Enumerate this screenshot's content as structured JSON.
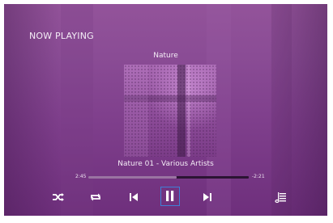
{
  "header": {
    "title": "NOW PLAYING"
  },
  "album": {
    "name": "Nature"
  },
  "track": {
    "info": "Nature 01 - Various Artists"
  },
  "progress": {
    "elapsed": "2:45",
    "remaining": "-2:21",
    "fraction": 0.55
  },
  "controls": {
    "shuffle_icon": "shuffle-icon",
    "repeat_icon": "repeat-icon",
    "previous_icon": "skip-previous-icon",
    "pause_icon": "pause-icon",
    "next_icon": "skip-next-icon",
    "queue_icon": "playlist-icon"
  },
  "colors": {
    "accent": "#3f7fd6",
    "background": "#8a4c95",
    "text": "#f4ecf6"
  }
}
